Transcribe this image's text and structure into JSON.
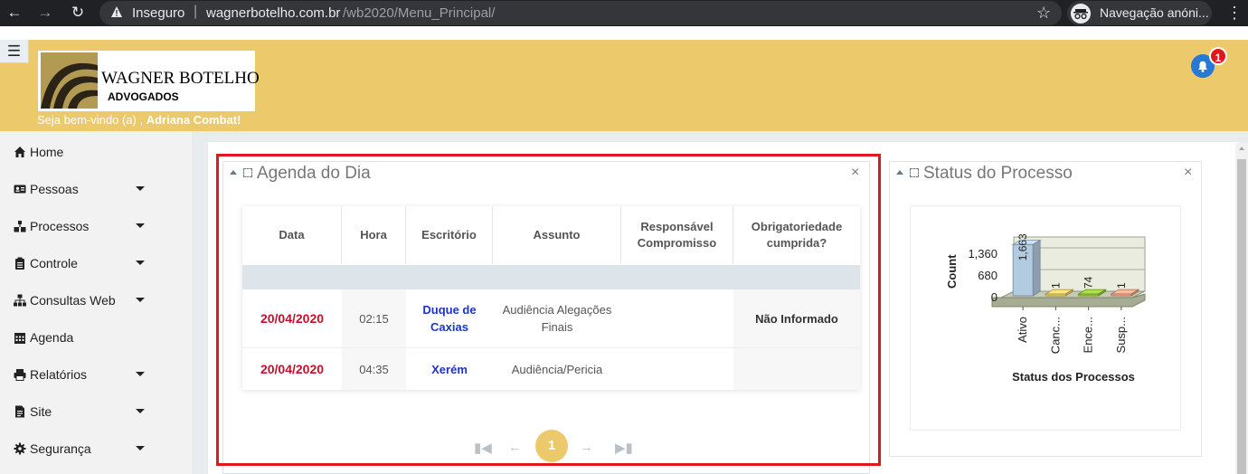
{
  "browser": {
    "insecure_label": "Inseguro",
    "url_domain": "wagnerbotelho.com.br",
    "url_path": "/wb2020/Menu_Principal/",
    "profile_label": "Navegação anóni..."
  },
  "header": {
    "logo_title": "WAGNER BOTELHO",
    "logo_subtitle": "ADVOGADOS",
    "welcome_prefix": "Seja bem-vindo (a) ,",
    "user_name": "Adriana Combat!",
    "notification_count": "1",
    "brand_color": "#ecca6b"
  },
  "sidebar": {
    "items": [
      {
        "label": "Home",
        "icon": "home-icon",
        "dropdown": false
      },
      {
        "label": "Pessoas",
        "icon": "id-card-icon",
        "dropdown": true
      },
      {
        "label": "Processos",
        "icon": "sitemap-icon",
        "dropdown": true
      },
      {
        "label": "Controle",
        "icon": "clipboard-icon",
        "dropdown": true
      },
      {
        "label": "Consultas Web",
        "icon": "network-icon",
        "dropdown": true
      },
      {
        "label": "Agenda",
        "icon": "calendar-icon",
        "dropdown": false
      },
      {
        "label": "Relatórios",
        "icon": "printer-icon",
        "dropdown": true
      },
      {
        "label": "Site",
        "icon": "file-icon",
        "dropdown": true
      },
      {
        "label": "Segurança",
        "icon": "gear-icon",
        "dropdown": true
      }
    ]
  },
  "agenda": {
    "title": "Agenda do Dia",
    "close_label": "×",
    "columns": [
      "Data",
      "Hora",
      "Escritório",
      "Assunto",
      "Responsável Compromisso",
      "Obrigatoriedade cumprida?"
    ],
    "rows": [
      {
        "date": "20/04/2020",
        "time": "02:15",
        "office": "Duque de Caxias",
        "subject": "Audiência Alegações Finais",
        "responsible": "",
        "obligation": "Não Informado"
      },
      {
        "date": "20/04/2020",
        "time": "04:35",
        "office": "Xerém",
        "subject": "Audiência/Pericia",
        "responsible": "",
        "obligation": ""
      }
    ],
    "pager": {
      "current_page": "1"
    }
  },
  "status": {
    "title": "Status do Processo",
    "close_label": "×"
  },
  "chart_data": {
    "type": "bar",
    "title": "",
    "xlabel": "Status dos Processos",
    "ylabel": "Count",
    "categories": [
      "Ativo",
      "Canc...",
      "Ence...",
      "Susp..."
    ],
    "values": [
      1663,
      1,
      74,
      1
    ],
    "value_labels": [
      "1,663",
      "1",
      "74",
      "1"
    ],
    "y_ticks": [
      "1,360",
      "680",
      "0"
    ],
    "ylim": [
      0,
      1700
    ],
    "grid": true,
    "bar_colors": [
      "#b3cbe0",
      "#f2d06b",
      "#9ccc3c",
      "#f4a98a"
    ],
    "style": "3d"
  }
}
